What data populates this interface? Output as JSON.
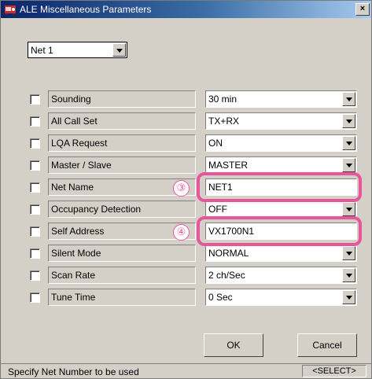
{
  "window": {
    "title": "ALE Miscellaneous Parameters",
    "close_glyph": "×"
  },
  "net_select": {
    "value": "Net  1"
  },
  "rows": [
    {
      "label": "Sounding",
      "value": "30 min",
      "kind": "combo"
    },
    {
      "label": "All Call Set",
      "value": "TX+RX",
      "kind": "combo"
    },
    {
      "label": "LQA Request",
      "value": "ON",
      "kind": "combo"
    },
    {
      "label": "Master / Slave",
      "value": "MASTER",
      "kind": "combo"
    },
    {
      "label": "Net Name",
      "value": "NET1",
      "kind": "text"
    },
    {
      "label": "Occupancy Detection",
      "value": "OFF",
      "kind": "combo"
    },
    {
      "label": "Self Address",
      "value": "VX1700N1",
      "kind": "text"
    },
    {
      "label": "Silent Mode",
      "value": "NORMAL",
      "kind": "combo"
    },
    {
      "label": "Scan Rate",
      "value": "2 ch/Sec",
      "kind": "combo"
    },
    {
      "label": "Tune Time",
      "value": "0 Sec",
      "kind": "combo"
    }
  ],
  "annotations": [
    {
      "marker": "③"
    },
    {
      "marker": "④"
    }
  ],
  "buttons": {
    "ok": "OK",
    "cancel": "Cancel"
  },
  "status": {
    "text": "Specify Net Number to be used",
    "right": "<SELECT>"
  },
  "colors": {
    "highlight": "#e8559a",
    "titlebar": "#0a246a"
  }
}
